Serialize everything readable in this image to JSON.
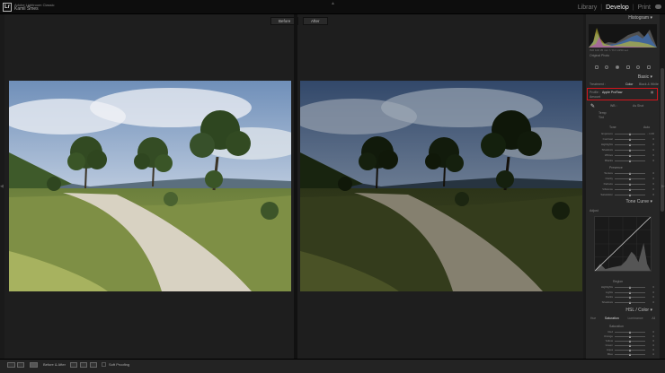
{
  "app": {
    "title": "Adobe Lightroom Classic",
    "user": "Kamil Šmes",
    "modules": [
      "Library",
      "Develop",
      "Print"
    ],
    "active_module": "Develop"
  },
  "view": {
    "before_label": "Before",
    "after_label": "After"
  },
  "toolbar": {
    "view_mode": "Before & After",
    "soft_proofing": "Soft Proofing"
  },
  "panel": {
    "histogram": {
      "title": "Histogram",
      "meta": "ISO 100   35 mm   f / 8.0   1/250 sec",
      "original_photo": "Original Photo"
    },
    "basic": {
      "title": "Basic",
      "treatment_label": "Treatment :",
      "color": "Color",
      "bw": "Black & White",
      "profile_label": "Profile :",
      "profile_value": "Apple ProRaw",
      "amount_label": "Amount",
      "wb_label": "WB :",
      "wb_value": "As Shot",
      "temp_label": "Temp",
      "tint_label": "Tint",
      "tone_label": "Tone",
      "auto_label": "Auto",
      "presence_label": "Presence",
      "tone_sliders": [
        {
          "label": "Exposure",
          "value": "- 1.00"
        },
        {
          "label": "Contrast",
          "value": "0"
        },
        {
          "label": "Highlights",
          "value": "0"
        },
        {
          "label": "Shadows",
          "value": "0"
        },
        {
          "label": "Whites",
          "value": "0"
        },
        {
          "label": "Blacks",
          "value": "0"
        }
      ],
      "presence_sliders": [
        {
          "label": "Texture",
          "value": "0"
        },
        {
          "label": "Clarity",
          "value": "0"
        },
        {
          "label": "Dehaze",
          "value": "0"
        },
        {
          "label": "Vibrance",
          "value": "0"
        },
        {
          "label": "Saturation",
          "value": "0"
        }
      ]
    },
    "tone_curve": {
      "title": "Tone Curve",
      "adjust_label": "Adjust",
      "region_label": "Region",
      "region_sliders": [
        {
          "label": "Highlights",
          "value": "0"
        },
        {
          "label": "Lights",
          "value": "0"
        },
        {
          "label": "Darks",
          "value": "0"
        },
        {
          "label": "Shadows",
          "value": "0"
        }
      ]
    },
    "hsl": {
      "title": "HSL / Color",
      "tabs": [
        "Hue",
        "Saturation",
        "Luminance",
        "All"
      ],
      "section": "Saturation",
      "sliders": [
        {
          "label": "Red",
          "value": "0"
        },
        {
          "label": "Orange",
          "value": "0"
        },
        {
          "label": "Yellow",
          "value": "0"
        },
        {
          "label": "Green",
          "value": "0"
        },
        {
          "label": "Aqua",
          "value": "0"
        },
        {
          "label": "Blue",
          "value": "0"
        }
      ]
    },
    "previous_button": "Previous",
    "reset_button": "Reset"
  },
  "colors": {
    "highlight_box": "#d4141c",
    "active_text": "#eeeeee"
  }
}
